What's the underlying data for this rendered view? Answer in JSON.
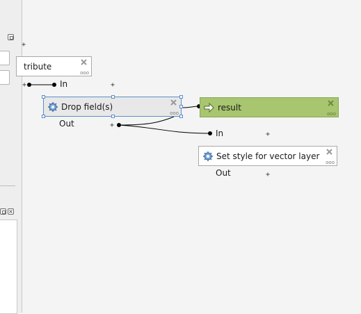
{
  "nodes": {
    "attribute": {
      "title": "tribute"
    },
    "drop_fields": {
      "title": "Drop field(s)",
      "in_label": "In",
      "out_label": "Out"
    },
    "result": {
      "title": "result"
    },
    "set_style": {
      "title": "Set style for vector layer",
      "in_label": "In",
      "out_label": "Out"
    }
  },
  "icons": {
    "algorithm": "gear-icon",
    "output": "output-arrow-icon",
    "remove": "close-icon",
    "more": "ellipsis-icon"
  },
  "colors": {
    "selected_border": "#5b8ec8",
    "output_fill": "#a8c56f",
    "node_fill": "#ffffff",
    "selected_fill": "#e8e8e8"
  },
  "glyphs": {
    "plus": "+",
    "more": "ooo"
  }
}
